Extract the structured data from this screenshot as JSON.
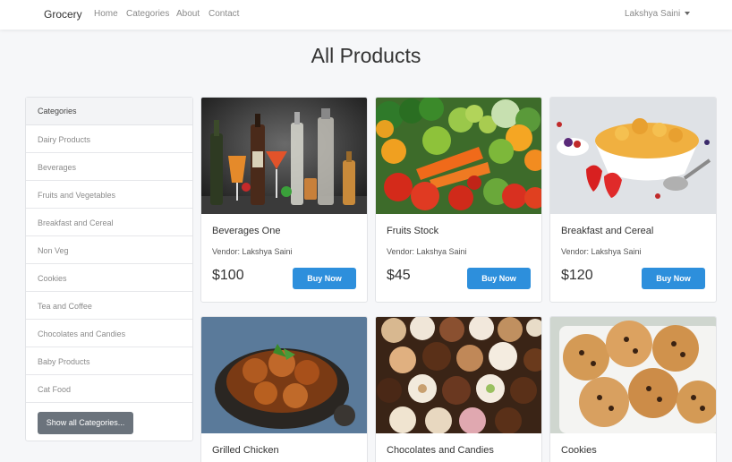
{
  "navbar": {
    "brand": "Grocery",
    "links": [
      "Home",
      "Categories",
      "About",
      "Contact"
    ],
    "user": "Lakshya Saini"
  },
  "page_title": "All Products",
  "sidebar": {
    "header": "Categories",
    "items": [
      "Dairy Products",
      "Beverages",
      "Fruits and Vegetables",
      "Breakfast and Cereal",
      "Non Veg",
      "Cookies",
      "Tea and Coffee",
      "Chocolates and Candies",
      "Baby Products",
      "Cat Food"
    ],
    "button": "Show all Categories..."
  },
  "products": [
    {
      "title": "Beverages One",
      "vendor": "Vendor: Lakshya Saini",
      "price": "$100",
      "button": "Buy Now"
    },
    {
      "title": "Fruits Stock",
      "vendor": "Vendor: Lakshya Saini",
      "price": "$45",
      "button": "Buy Now"
    },
    {
      "title": "Breakfast and Cereal",
      "vendor": "Vendor: Lakshya Saini",
      "price": "$120",
      "button": "Buy Now"
    },
    {
      "title": "Grilled Chicken"
    },
    {
      "title": "Chocolates and Candies"
    },
    {
      "title": "Cookies"
    }
  ]
}
